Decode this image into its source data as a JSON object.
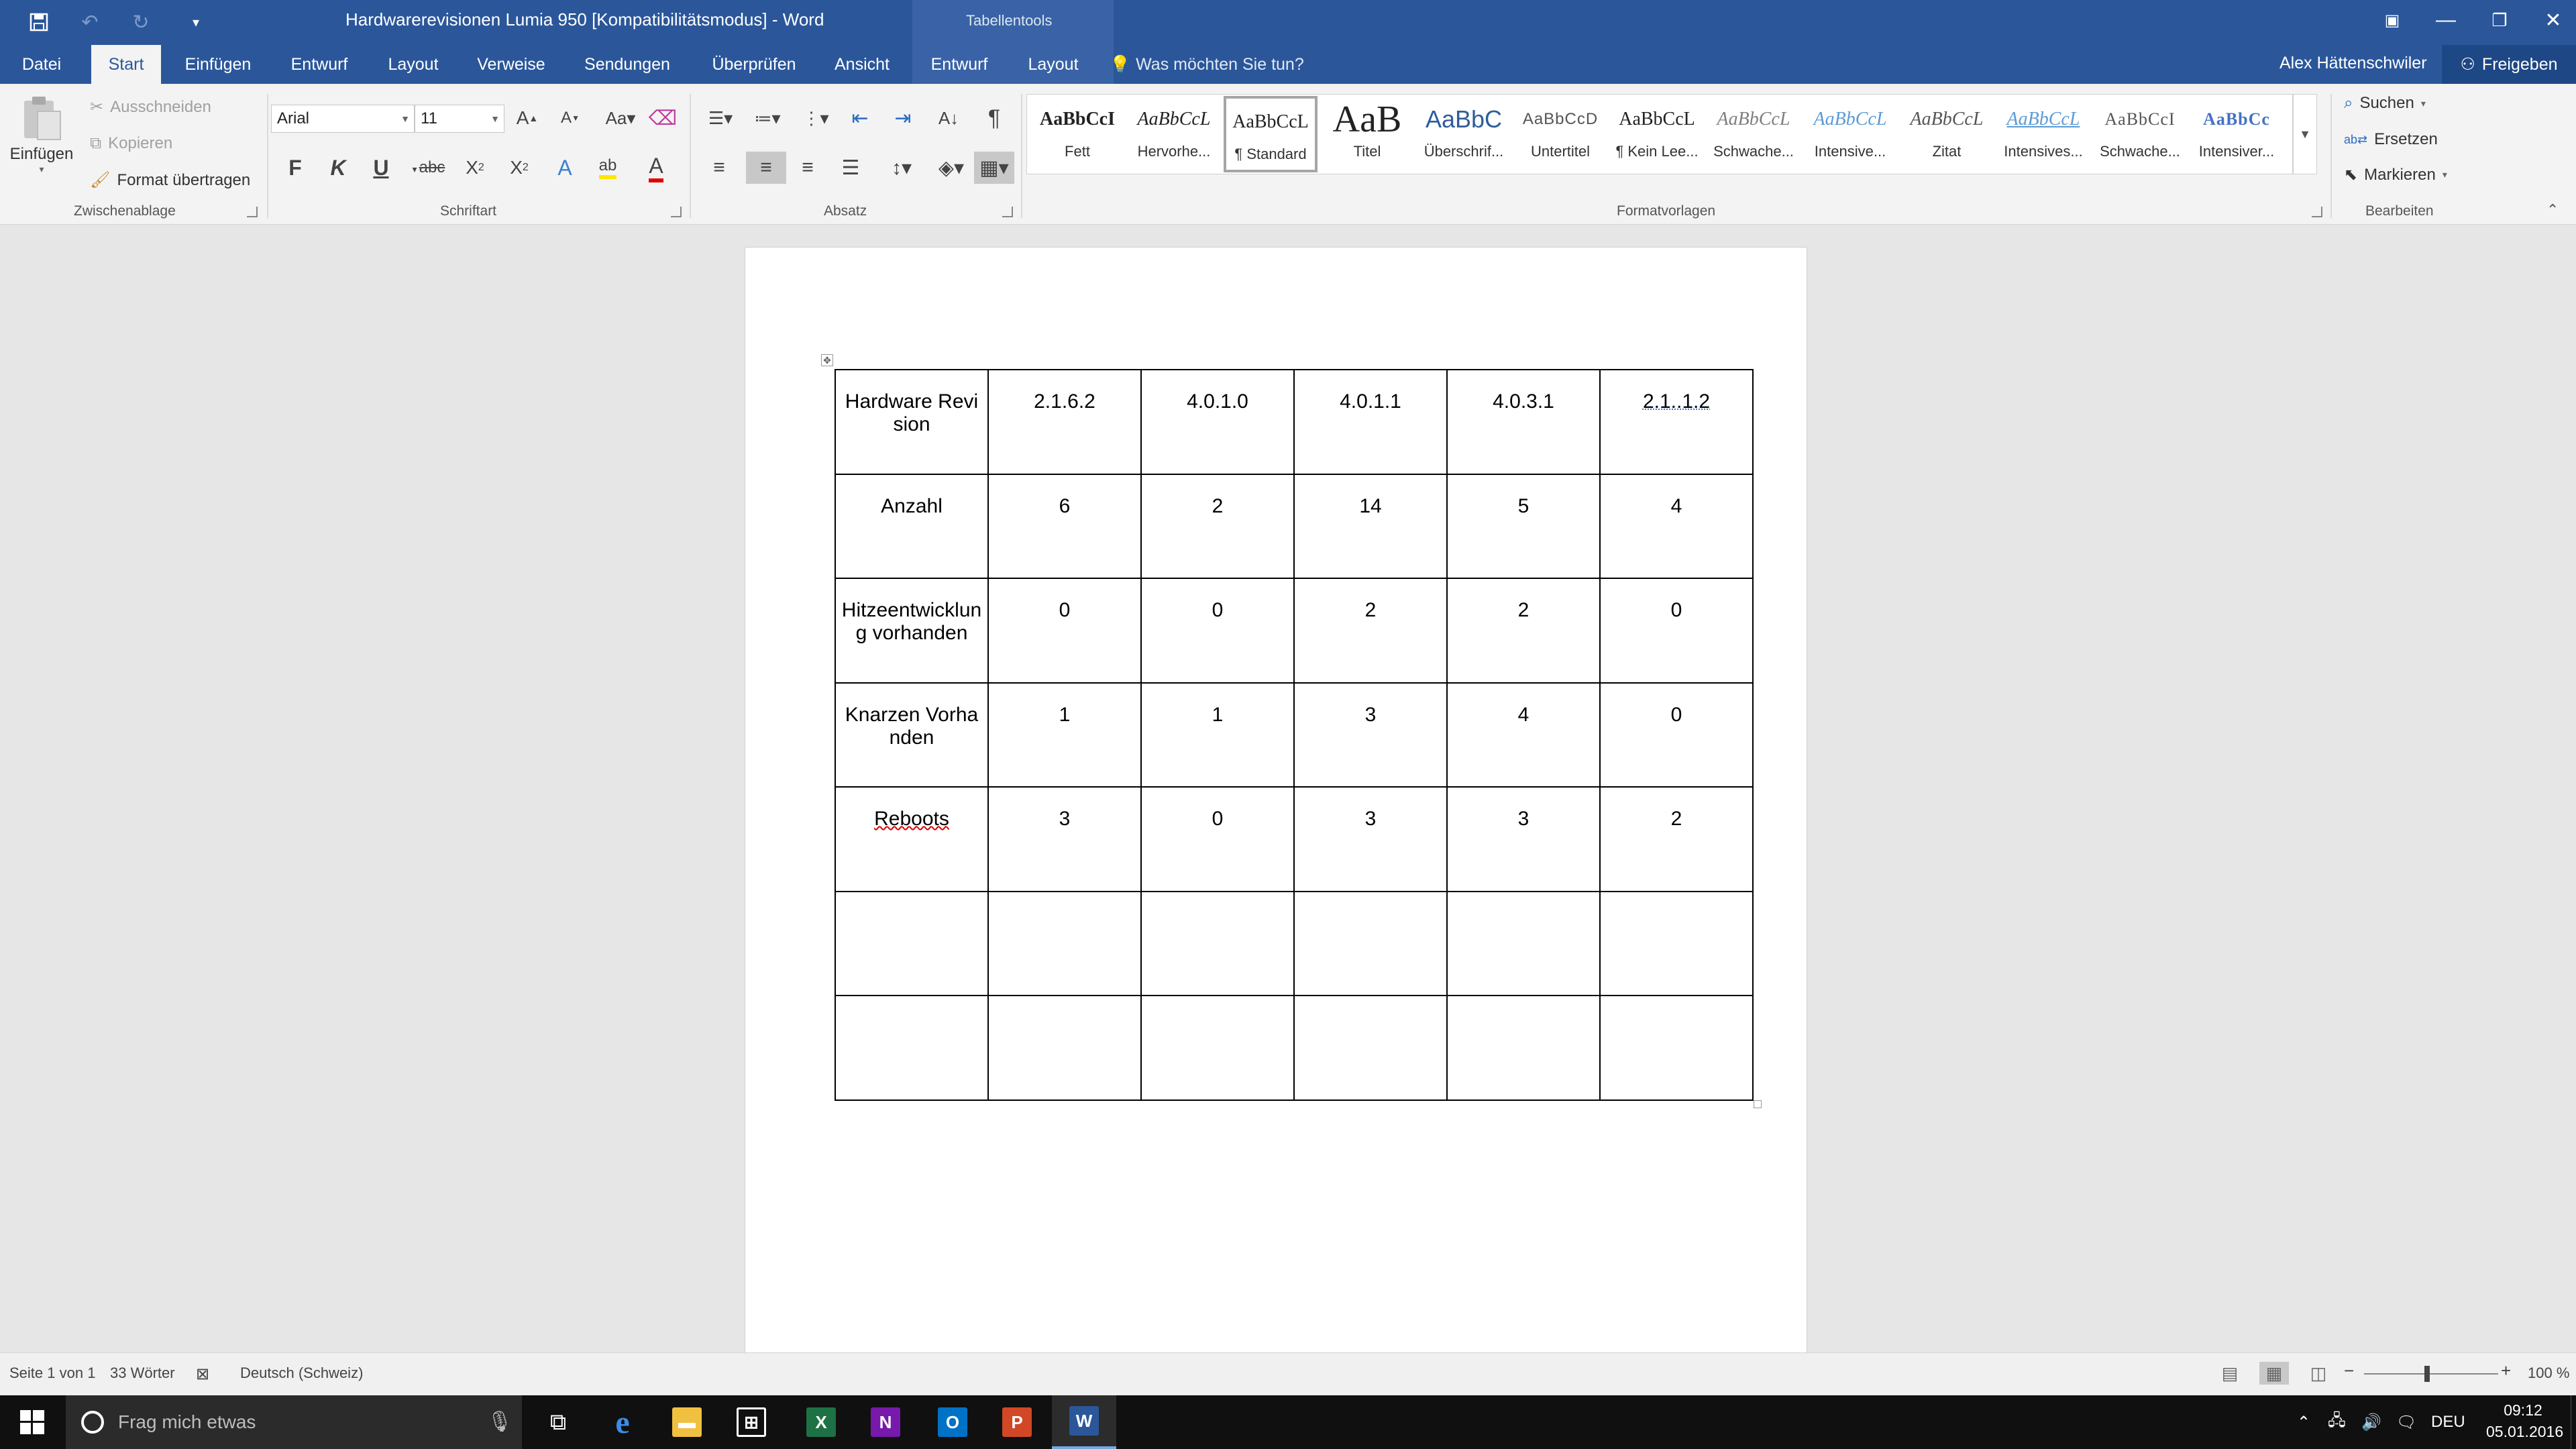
{
  "window": {
    "title": "Hardwarerevisionen Lumia 950 [Kompatibilitätsmodus] - Word",
    "context_tab_group": "Tabellentools"
  },
  "tabs": [
    "Datei",
    "Start",
    "Einfügen",
    "Entwurf",
    "Layout",
    "Verweise",
    "Sendungen",
    "Überprüfen",
    "Ansicht",
    "Entwurf",
    "Layout"
  ],
  "active_tab": "Start",
  "tell_me": "Was möchten Sie tun?",
  "user": "Alex Hättenschwiler",
  "share": "Freigeben",
  "clipboard": {
    "paste": "Einfügen",
    "cut": "Ausschneiden",
    "copy": "Kopieren",
    "format_painter": "Format übertragen",
    "group": "Zwischenablage"
  },
  "font": {
    "name": "Arial",
    "size": "11",
    "bold": "F",
    "italic": "K",
    "underline": "U",
    "strike": "abc",
    "group": "Schriftart"
  },
  "paragraph": {
    "group": "Absatz"
  },
  "styles": {
    "group": "Formatvorlagen",
    "items": [
      {
        "sample": "AaBbCcI",
        "name": "Fett"
      },
      {
        "sample": "AaBbCcL",
        "name": "Hervorhe..."
      },
      {
        "sample": "AaBbCcL",
        "name": "¶ Standard"
      },
      {
        "sample": "AaB",
        "name": "Titel"
      },
      {
        "sample": "AaBbC",
        "name": "Überschrif..."
      },
      {
        "sample": "AaBbCcD",
        "name": "Untertitel"
      },
      {
        "sample": "AaBbCcL",
        "name": "¶ Kein Lee..."
      },
      {
        "sample": "AaBbCcL",
        "name": "Schwache..."
      },
      {
        "sample": "AaBbCcL",
        "name": "Intensive..."
      },
      {
        "sample": "AaBbCcL",
        "name": "Zitat"
      },
      {
        "sample": "AaBbCcL",
        "name": "Intensives..."
      },
      {
        "sample": "AaBbCcI",
        "name": "Schwache..."
      },
      {
        "sample": "AaBbCc",
        "name": "Intensiver..."
      }
    ]
  },
  "editing": {
    "find": "Suchen",
    "replace": "Ersetzen",
    "select": "Markieren",
    "group": "Bearbeiten"
  },
  "table": {
    "rows": [
      [
        "Hardware Revision",
        "2.1.6.2",
        "4.0.1.0",
        "4.0.1.1",
        "4.0.3.1",
        "2.1..1.2"
      ],
      [
        "Anzahl",
        "6",
        "2",
        "14",
        "5",
        "4"
      ],
      [
        "Hitzeentwicklung vorhanden",
        "0",
        "0",
        "2",
        "2",
        "0"
      ],
      [
        "Knarzen Vorhanden",
        "1",
        "1",
        "3",
        "4",
        "0"
      ],
      [
        "Reboots",
        "3",
        "0",
        "3",
        "3",
        "2"
      ],
      [
        "",
        "",
        "",
        "",
        "",
        ""
      ],
      [
        "",
        "",
        "",
        "",
        "",
        ""
      ]
    ]
  },
  "status": {
    "page": "Seite 1 von 1",
    "words": "33 Wörter",
    "language": "Deutsch (Schweiz)",
    "zoom": "100 %"
  },
  "taskbar": {
    "search_placeholder": "Frag mich etwas",
    "lang": "DEU",
    "time": "09:12",
    "date": "05.01.2016"
  }
}
